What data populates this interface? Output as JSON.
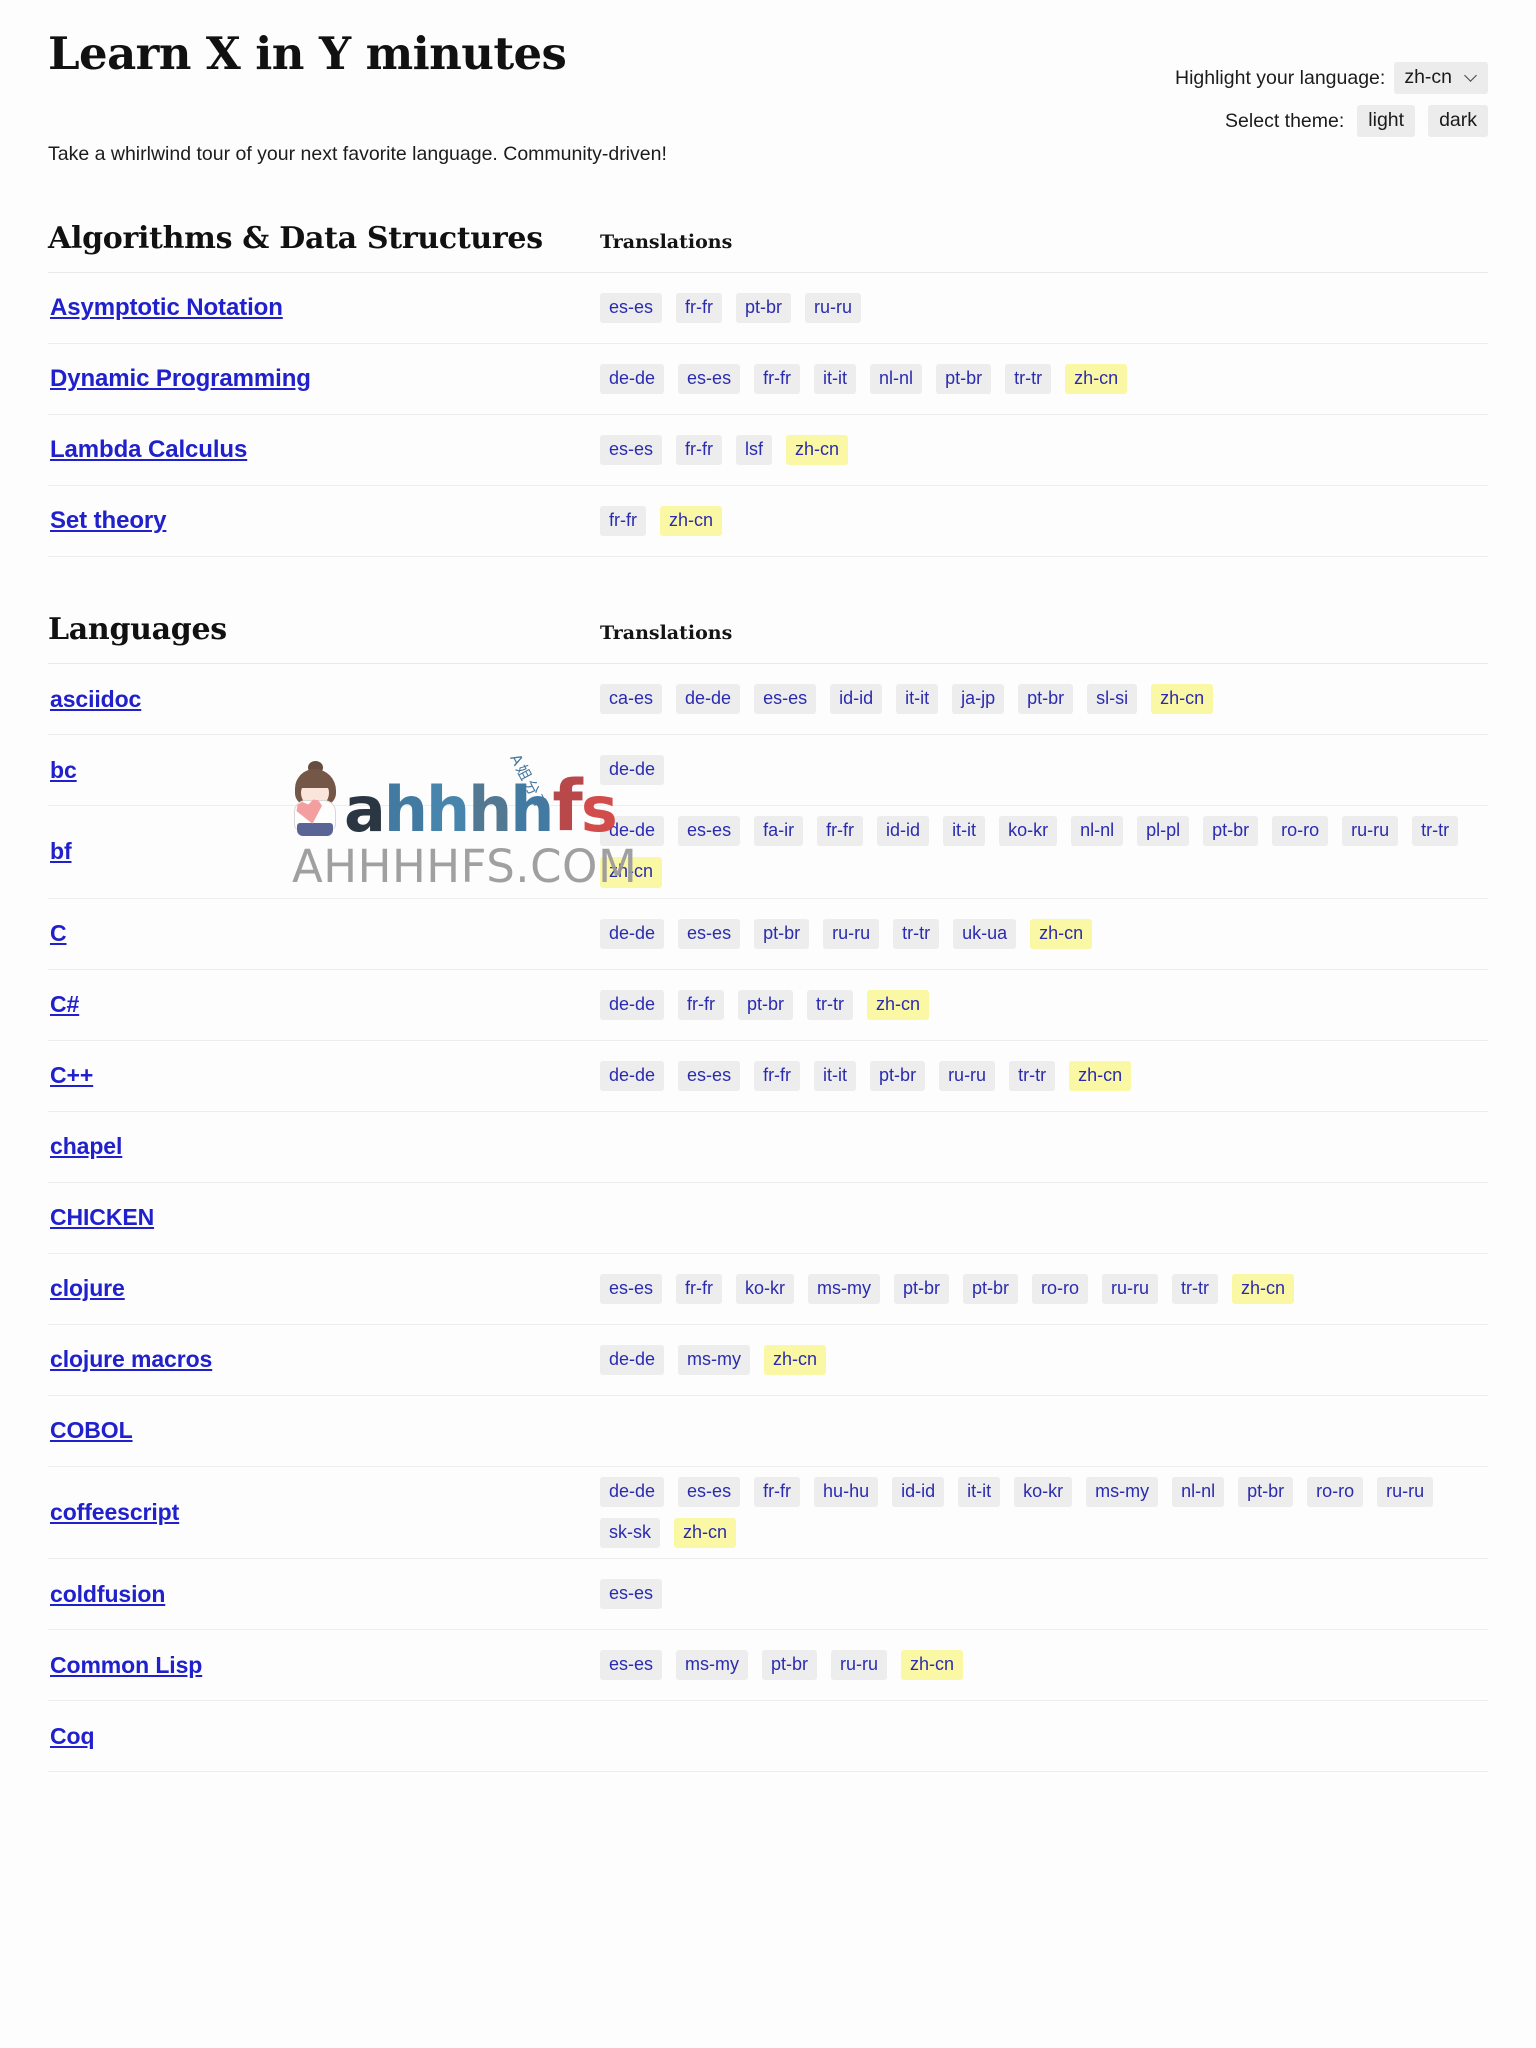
{
  "header": {
    "title": "Learn X in Y minutes",
    "highlight_label": "Highlight your language:",
    "highlight_value": "zh-cn",
    "theme_label": "Select theme:",
    "theme_light": "light",
    "theme_dark": "dark",
    "tagline": "Take a whirlwind tour of your next favorite language. Community-driven!"
  },
  "colors": {
    "link": "#2020cc",
    "badge_bg": "#ededed",
    "badge_text": "#2b2bb0",
    "badge_highlight_bg": "#fbf8a5",
    "control_bg": "#ececec"
  },
  "sections": [
    {
      "title": "Algorithms & Data Structures",
      "translations_header": "Translations",
      "rows": [
        {
          "name": "Asymptotic Notation",
          "translations": [
            "es-es",
            "fr-fr",
            "pt-br",
            "ru-ru"
          ]
        },
        {
          "name": "Dynamic Programming",
          "translations": [
            "de-de",
            "es-es",
            "fr-fr",
            "it-it",
            "nl-nl",
            "pt-br",
            "tr-tr",
            "zh-cn"
          ]
        },
        {
          "name": "Lambda Calculus",
          "translations": [
            "es-es",
            "fr-fr",
            "lsf",
            "zh-cn"
          ]
        },
        {
          "name": "Set theory",
          "translations": [
            "fr-fr",
            "zh-cn"
          ]
        }
      ]
    },
    {
      "title": "Languages",
      "translations_header": "Translations",
      "rows": [
        {
          "name": "asciidoc",
          "translations": [
            "ca-es",
            "de-de",
            "es-es",
            "id-id",
            "it-it",
            "ja-jp",
            "pt-br",
            "sl-si",
            "zh-cn"
          ]
        },
        {
          "name": "bc",
          "translations": [
            "de-de"
          ]
        },
        {
          "name": "bf",
          "translations": [
            "de-de",
            "es-es",
            "fa-ir",
            "fr-fr",
            "id-id",
            "it-it",
            "ko-kr",
            "nl-nl",
            "pl-pl",
            "pt-br",
            "ro-ro",
            "ru-ru",
            "tr-tr",
            "zh-cn"
          ]
        },
        {
          "name": "C",
          "translations": [
            "de-de",
            "es-es",
            "pt-br",
            "ru-ru",
            "tr-tr",
            "uk-ua",
            "zh-cn"
          ]
        },
        {
          "name": "C#",
          "translations": [
            "de-de",
            "fr-fr",
            "pt-br",
            "tr-tr",
            "zh-cn"
          ]
        },
        {
          "name": "C++",
          "translations": [
            "de-de",
            "es-es",
            "fr-fr",
            "it-it",
            "pt-br",
            "ru-ru",
            "tr-tr",
            "zh-cn"
          ]
        },
        {
          "name": "chapel",
          "translations": []
        },
        {
          "name": "CHICKEN",
          "translations": []
        },
        {
          "name": "clojure",
          "translations": [
            "es-es",
            "fr-fr",
            "ko-kr",
            "ms-my",
            "pt-br",
            "pt-br",
            "ro-ro",
            "ru-ru",
            "tr-tr",
            "zh-cn"
          ]
        },
        {
          "name": "clojure macros",
          "translations": [
            "de-de",
            "ms-my",
            "zh-cn"
          ]
        },
        {
          "name": "COBOL",
          "translations": []
        },
        {
          "name": "coffeescript",
          "translations": [
            "de-de",
            "es-es",
            "fr-fr",
            "hu-hu",
            "id-id",
            "it-it",
            "ko-kr",
            "ms-my",
            "nl-nl",
            "pt-br",
            "ro-ro",
            "ru-ru",
            "sk-sk",
            "zh-cn"
          ]
        },
        {
          "name": "coldfusion",
          "translations": [
            "es-es"
          ]
        },
        {
          "name": "Common Lisp",
          "translations": [
            "es-es",
            "ms-my",
            "pt-br",
            "ru-ru",
            "zh-cn"
          ]
        },
        {
          "name": "Coq",
          "translations": []
        }
      ]
    }
  ],
  "watermark": {
    "brand": "ahhhhfs",
    "domain": "AHHHHFS.COM",
    "tagline_cn": "A姐分享"
  },
  "highlighted_language": "zh-cn"
}
